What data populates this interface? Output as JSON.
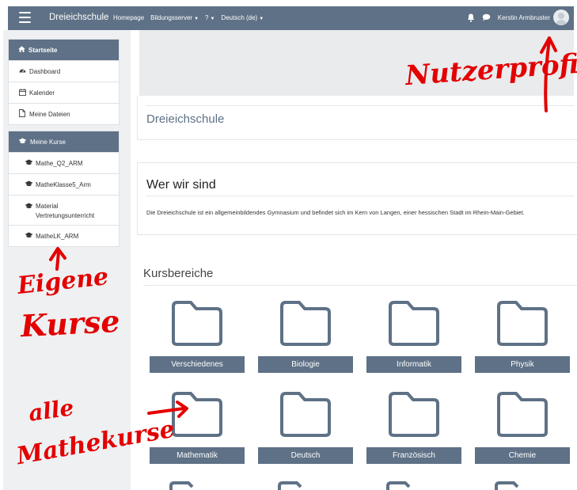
{
  "navbar": {
    "brand": "Dreieichschule",
    "links": [
      {
        "label": "Homepage",
        "caret": false
      },
      {
        "label": "Bildungsserver",
        "caret": true
      },
      {
        "label": "?",
        "caret": true
      },
      {
        "label": "Deutsch (de)",
        "caret": true
      }
    ],
    "username": "Kerstin Armbruster"
  },
  "drawer": {
    "main_head": "Startseite",
    "main_items": [
      "Dashboard",
      "Kalender",
      "Meine Dateien"
    ],
    "courses_head": "Meine Kurse",
    "courses": [
      "Mathe_Q2_ARM",
      "MatheKlasse5_Arm",
      "Material Vertretungsunterricht",
      "MatheLK_ARM"
    ]
  },
  "site_title": "Dreieichschule",
  "about": {
    "title": "Wer wir sind",
    "text": "Die Dreieichschule ist ein allgemeinbildendes Gymnasium und befindet sich im Kern von Langen, einer hessischen Stadt im Rhein-Main-Gebiet."
  },
  "categories_title": "Kursbereiche",
  "categories": [
    "Verschiedenes",
    "Biologie",
    "Informatik",
    "Physik",
    "Mathematik",
    "Deutsch",
    "Französisch",
    "Chemie"
  ],
  "annotations": {
    "profile": "Nutzerprofil",
    "own_courses_1": "Eigene",
    "own_courses_2": "Kurse",
    "math_1": "alle",
    "math_2": "Mathekurse"
  },
  "colors": {
    "accent": "#5e7186",
    "annotation": "#e30000"
  }
}
